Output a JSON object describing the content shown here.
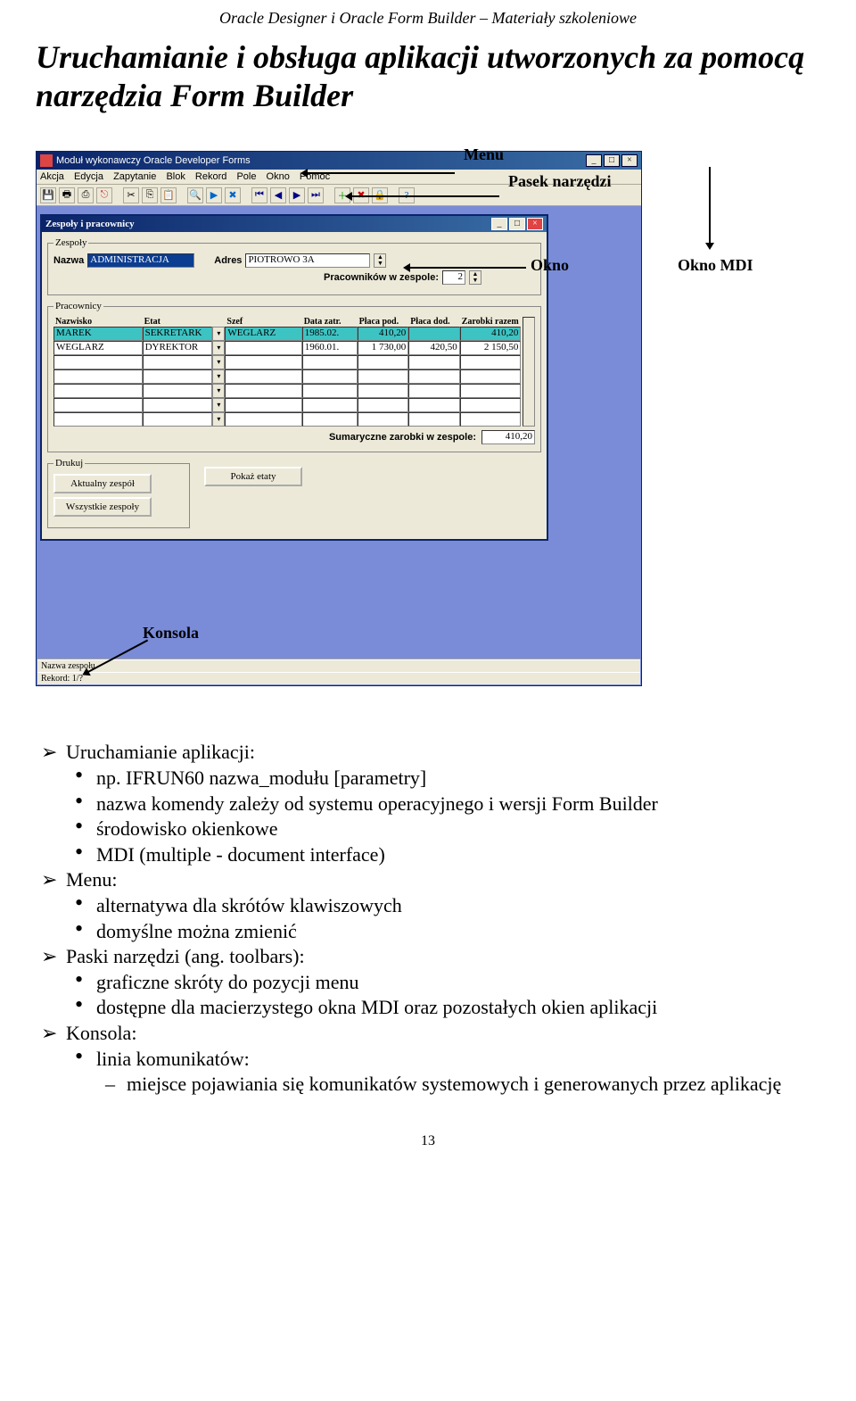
{
  "doc_header": "Oracle Designer i Oracle Form Builder – Materiały szkoleniowe",
  "main_title": "Uruchamianie i obsługa aplikacji utworzonych za pomocą narzędzia Form Builder",
  "page_number": "13",
  "annotations": {
    "menu": "Menu",
    "toolbar": "Pasek narzędzi",
    "window": "Okno",
    "mdi": "Okno MDI",
    "console": "Konsola"
  },
  "mdi_title": "Moduł wykonawczy Oracle Developer Forms",
  "menubar": [
    "Akcja",
    "Edycja",
    "Zapytanie",
    "Blok",
    "Rekord",
    "Pole",
    "Okno",
    "Pomoc"
  ],
  "inner_title": "Zespoły i pracownicy",
  "zespoly": {
    "legend": "Zespoły",
    "nazwa_label": "Nazwa",
    "nazwa_value": "ADMINISTRACJA",
    "adres_label": "Adres",
    "adres_value": "PIOTROWO 3A",
    "prac_label": "Pracowników w zespole:",
    "prac_value": "2"
  },
  "pracownicy": {
    "legend": "Pracownicy",
    "headers": [
      "Nazwisko",
      "Etat",
      "Szef",
      "Data zatr.",
      "Płaca pod.",
      "Płaca dod.",
      "Zarobki razem"
    ],
    "rows": [
      {
        "nazwisko": "MAREK",
        "etat": "SEKRETARK",
        "szef": "WEGLARZ",
        "data": "1985.02.",
        "ppod": "410,20",
        "pdod": "",
        "razem": "410,20",
        "hi": true
      },
      {
        "nazwisko": "WEGLARZ",
        "etat": "DYREKTOR",
        "szef": "",
        "data": "1960.01.",
        "ppod": "1 730,00",
        "pdod": "420,50",
        "razem": "2 150,50",
        "hi": false
      }
    ],
    "sum_label": "Sumaryczne zarobki w zespole:",
    "sum_value": "410,20"
  },
  "drukuj": {
    "legend": "Drukuj",
    "btn1": "Aktualny zespół",
    "btn2": "Wszystkie zespoły"
  },
  "btn_etaty": "Pokaż etaty",
  "status": {
    "line1": "Nazwa zespołu",
    "line2": "Rekord: 1/?"
  },
  "body": {
    "l1": "Uruchamianie aplikacji:",
    "l1a": "np. IFRUN60 nazwa_modułu [parametry]",
    "l1b": "nazwa komendy zależy od systemu operacyjnego i wersji Form Builder",
    "l1c": "środowisko okienkowe",
    "l1d": "MDI (multiple - document interface)",
    "l2": "Menu:",
    "l2a": "alternatywa dla skrótów klawiszowych",
    "l2b": "domyślne można zmienić",
    "l3": "Paski narzędzi (ang. toolbars):",
    "l3a": "graficzne skróty do pozycji menu",
    "l3b": "dostępne dla macierzystego okna MDI oraz pozostałych okien aplikacji",
    "l4": "Konsola:",
    "l4a": "linia komunikatów:",
    "l4a1": "miejsce pojawiania się komunikatów systemowych i generowanych przez aplikację"
  }
}
